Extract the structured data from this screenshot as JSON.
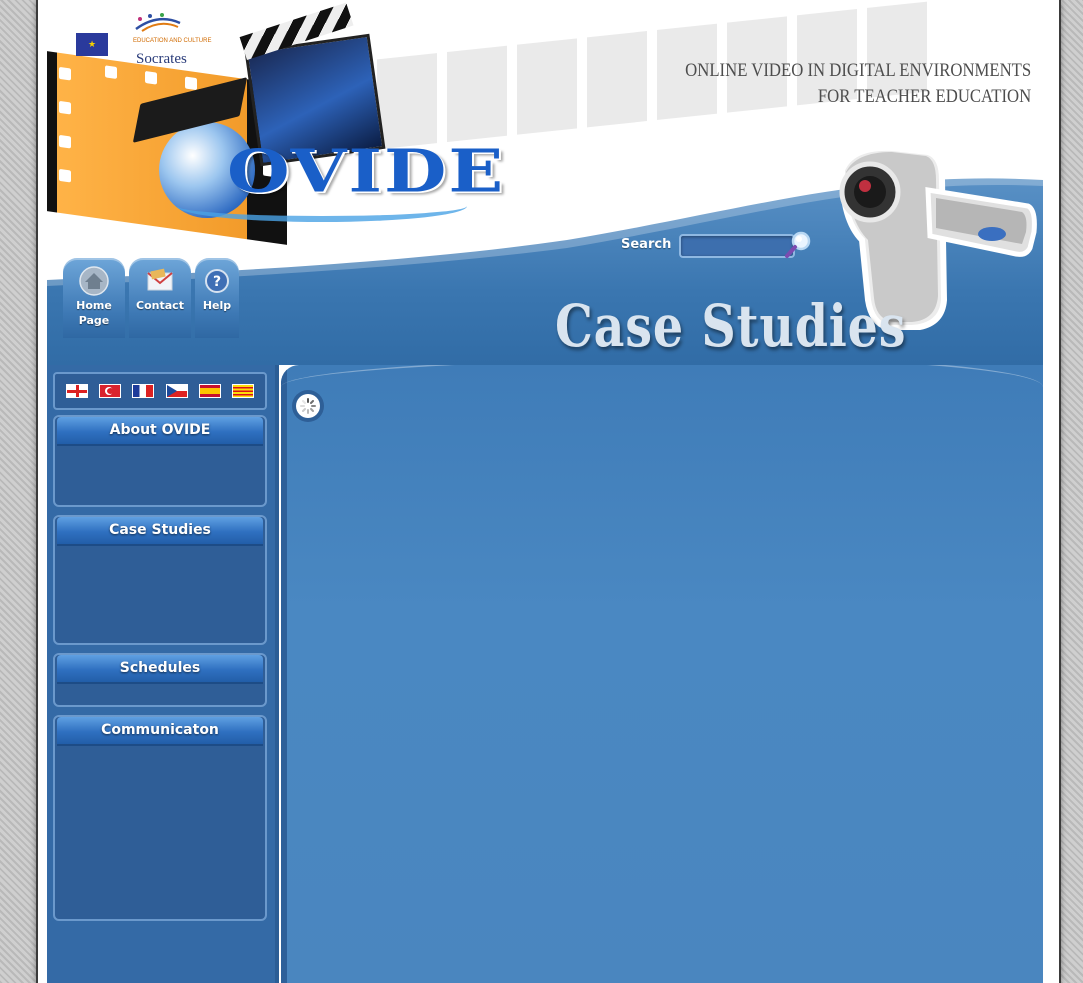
{
  "header": {
    "brand_program": "Socrates",
    "brand_dg": "EDUCATION AND CULTURE",
    "logo_text": "OVIDE",
    "tagline_line1": "ONLINE VIDEO  IN DIGITAL ENVIRONMENTS",
    "tagline_line2": "FOR TEACHER EDUCATION",
    "page_heading": "Case Studies"
  },
  "search": {
    "label": "Search",
    "value": ""
  },
  "nav": {
    "tabs": [
      {
        "label_line1": "Home",
        "label_line2": "Page",
        "icon": "home-icon"
      },
      {
        "label_line1": "Contact",
        "label_line2": "",
        "icon": "envelope-icon"
      },
      {
        "label_line1": "Help",
        "label_line2": "",
        "icon": "help-icon"
      }
    ]
  },
  "languages": [
    {
      "code": "en",
      "name": "England",
      "icon": "flag-england-icon"
    },
    {
      "code": "tr",
      "name": "Turkey",
      "icon": "flag-turkey-icon"
    },
    {
      "code": "fr",
      "name": "France",
      "icon": "flag-france-icon"
    },
    {
      "code": "cz",
      "name": "Czech Republic",
      "icon": "flag-czech-icon"
    },
    {
      "code": "es",
      "name": "Spain",
      "icon": "flag-spain-icon"
    },
    {
      "code": "ca",
      "name": "Catalonia",
      "icon": "flag-catalonia-icon"
    }
  ],
  "sidebar": {
    "panels": [
      {
        "title": "About OVIDE"
      },
      {
        "title": "Case Studies"
      },
      {
        "title": "Schedules"
      },
      {
        "title": "Communicaton"
      }
    ]
  },
  "colors": {
    "accent_blue": "#346aa6",
    "content_blue": "#4a88c2",
    "logo_blue": "#1a5fc8"
  }
}
